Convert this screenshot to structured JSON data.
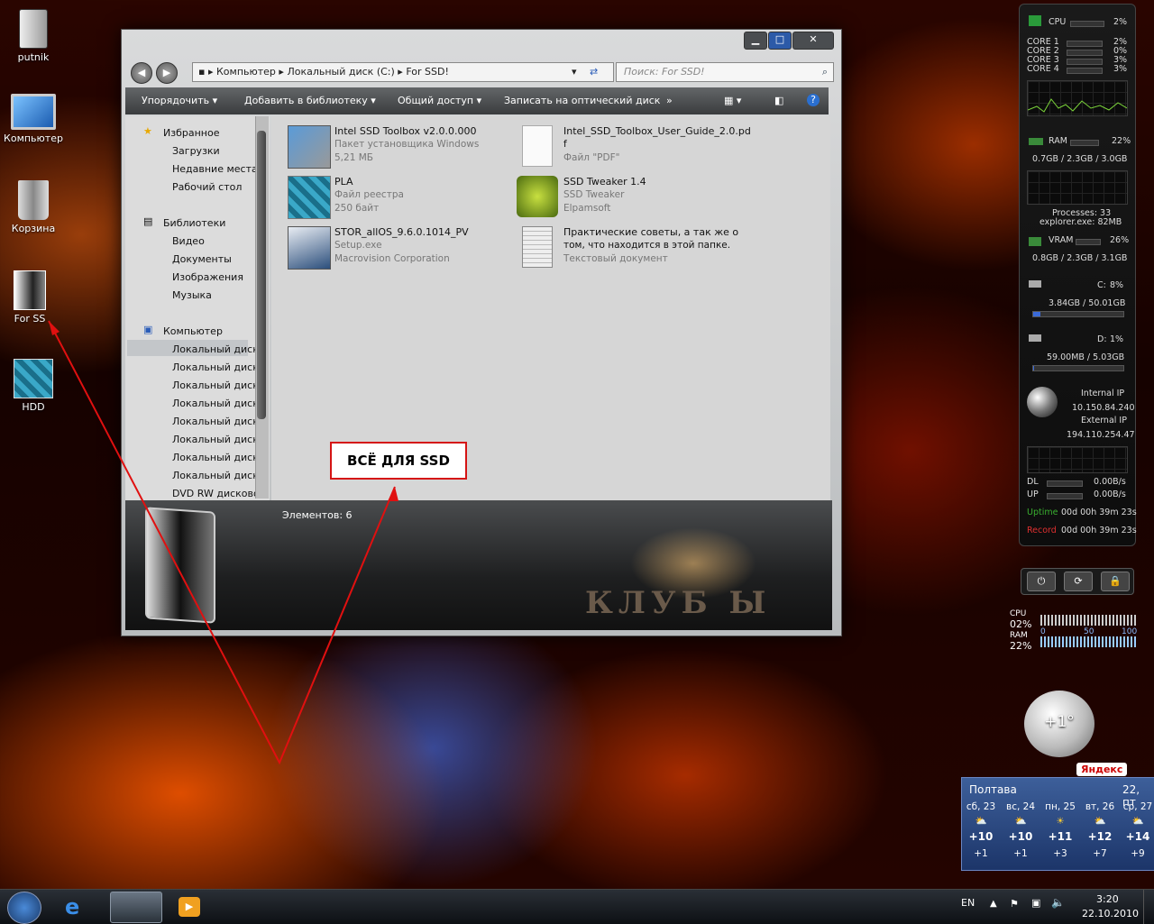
{
  "desktop_icons": [
    {
      "label": "putnik",
      "icon": "drive-icon"
    },
    {
      "label": "Компьютер",
      "icon": "computer-icon"
    },
    {
      "label": "Корзина",
      "icon": "recycle-bin-icon"
    },
    {
      "label": "For SS",
      "icon": "folder-shortcut-icon"
    },
    {
      "label": "HDD",
      "icon": "registry-file-icon"
    }
  ],
  "window": {
    "controls": {
      "minimize": "▁",
      "maximize": "□",
      "close": "✕"
    },
    "breadcrumb": [
      "Компьютер",
      "Локальный диск (C:)",
      "For SSD!"
    ],
    "search_placeholder": "Поиск: For SSD!",
    "toolbar": [
      "Упорядочить ▾",
      "Добавить в библиотеку ▾",
      "Общий доступ ▾",
      "Записать на оптический диск",
      "»"
    ],
    "nav": {
      "favorites_title": "Избранное",
      "favorites": [
        "Загрузки",
        "Недавние места",
        "Рабочий стол"
      ],
      "libraries_title": "Библиотеки",
      "libraries": [
        "Видео",
        "Документы",
        "Изображения",
        "Музыка"
      ],
      "computer_title": "Компьютер",
      "drives": [
        "Локальный диск (",
        "Локальный диск (",
        "Локальный диск (",
        "Локальный диск (",
        "Локальный диск (",
        "Локальный диск (",
        "Локальный диск (",
        "Локальный диск ("
      ],
      "dvd": "DVD RW дисково"
    },
    "files": [
      {
        "name": "Intel SSD Toolbox v2.0.0.000",
        "type": "Пакет установщика Windows",
        "extra": "5,21 МБ",
        "icon": "installer-icon"
      },
      {
        "name": "Intel_SSD_Toolbox_User_Guide_2.0.pd",
        "type": "f",
        "extra": "Файл \"PDF\"",
        "icon": "pdf-file-icon"
      },
      {
        "name": "PLA",
        "type": "Файл реестра",
        "extra": "250 байт",
        "icon": "registry-file-icon"
      },
      {
        "name": "SSD Tweaker 1.4",
        "type": "SSD Tweaker",
        "extra": "Elpamsoft",
        "icon": "ssd-tweaker-icon"
      },
      {
        "name": "STOR_allOS_9.6.0.1014_PV",
        "type": "Setup.exe",
        "extra": "Macrovision Corporation",
        "icon": "setup-exe-icon"
      },
      {
        "name": "Практические советы, а так же о",
        "type": "том, что находится в этой папке.",
        "extra": "Текстовый документ",
        "icon": "text-document-icon"
      }
    ],
    "status": "Элементов: 6",
    "branding": "КЛУБ Ы"
  },
  "annotation": "ВСЁ ДЛЯ SSD",
  "gadget": {
    "cpu_label": "CPU",
    "cpu_val": "2%",
    "cores": [
      {
        "n": "CORE 1",
        "v": "2%"
      },
      {
        "n": "CORE 2",
        "v": "0%"
      },
      {
        "n": "CORE 3",
        "v": "3%"
      },
      {
        "n": "CORE 4",
        "v": "3%"
      }
    ],
    "ram_label": "RAM",
    "ram_val": "22%",
    "ram_detail": "0.7GB / 2.3GB / 3.0GB",
    "processes": "Processes: 33",
    "top_proc": "explorer.exe: 82MB",
    "vram_label": "VRAM",
    "vram_val": "26%",
    "vram_detail": "0.8GB / 2.3GB / 3.1GB",
    "c_label": "C:",
    "c_val": "8%",
    "c_detail": "3.84GB / 50.01GB",
    "d_label": "D:",
    "d_val": "1%",
    "d_detail": "59.00MB / 5.03GB",
    "internal_ip_label": "Internal IP",
    "internal_ip": "10.150.84.240",
    "external_ip_label": "External IP",
    "external_ip": "194.110.254.47",
    "dl_label": "DL",
    "dl_val": "0.00B/s",
    "up_label": "UP",
    "up_val": "0.00B/s",
    "uptime_label": "Uptime",
    "uptime": "00d 00h 39m 23s",
    "record_label": "Record",
    "record": "00d 00h 39m 23s"
  },
  "meter": {
    "cpu_label": "CPU",
    "cpu_val": "02%",
    "ram_label": "RAM",
    "ram_val": "22%",
    "scale": [
      "0",
      "50",
      "100"
    ]
  },
  "weather": {
    "temp": "+1°",
    "brand": "Яндекс",
    "city": "Полтава",
    "date": "22, пт",
    "days": [
      {
        "d": "сб, 23",
        "t": "+10",
        "n": "+1"
      },
      {
        "d": "вс, 24",
        "t": "+10",
        "n": "+1"
      },
      {
        "d": "пн, 25",
        "t": "+11",
        "n": "+3"
      },
      {
        "d": "вт, 26",
        "t": "+12",
        "n": "+7"
      },
      {
        "d": "ср, 27",
        "t": "+14",
        "n": "+9"
      }
    ]
  },
  "taskbar": {
    "lang": "EN",
    "time": "3:20",
    "date": "22.10.2010"
  }
}
